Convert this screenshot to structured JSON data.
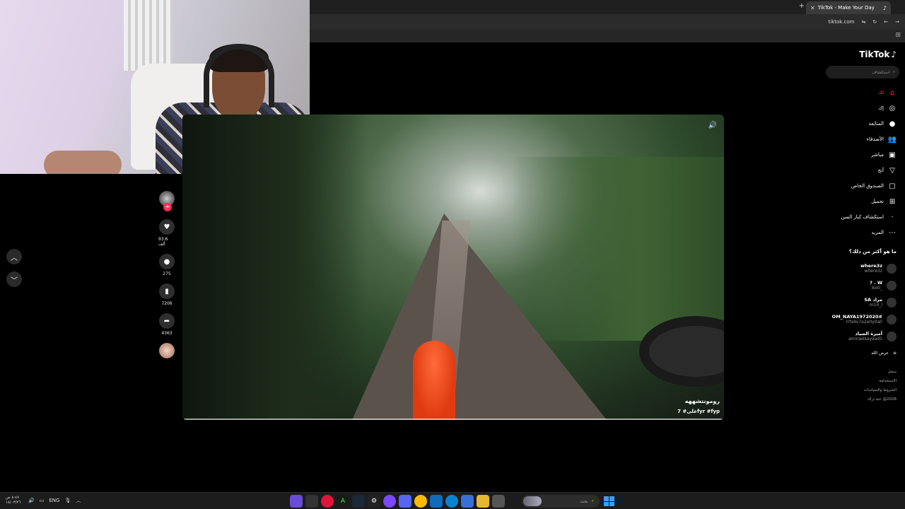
{
  "browser": {
    "tab_title": "TikTok - Make Your Day",
    "url": "tiktok.com",
    "new_tab": "+",
    "tab_close": "✕"
  },
  "video": {
    "title": "رومونتشههه",
    "tags": "على# 7fyr #fyp",
    "volume_icon": "🔊"
  },
  "actions": {
    "follow": "+",
    "like_count": "93.6 ألف",
    "comment_count": "275",
    "save_count": "7206",
    "share_count": "4363"
  },
  "sidebar": {
    "logo": "TikTok",
    "search_placeholder": "استكشاف",
    "nav": [
      {
        "label": "لك",
        "icon": "home-icon",
        "glyph": "⌂"
      },
      {
        "label": "إك",
        "icon": "compass-icon",
        "glyph": "◎"
      },
      {
        "label": "المتابَعة",
        "icon": "following-icon",
        "glyph": "●"
      },
      {
        "label": "الأصدقاء",
        "icon": "friends-icon",
        "glyph": "👥"
      },
      {
        "label": "مباشر",
        "icon": "live-icon",
        "glyph": "▣"
      },
      {
        "label": "آنج",
        "icon": "send-icon",
        "glyph": "▽"
      },
      {
        "label": "الصندوق الخاص",
        "icon": "inbox-icon",
        "glyph": "▢"
      },
      {
        "label": "تحميل",
        "icon": "upload-icon",
        "glyph": "⊞"
      },
      {
        "label": "استكشاف كبار السن",
        "icon": "discover-icon",
        "glyph": "·"
      },
      {
        "label": "المزيد",
        "icon": "more-icon",
        "glyph": "⋯"
      }
    ],
    "following_title": "ما هو أكثر من ذلك؟",
    "following": [
      {
        "name": "where3z",
        "handle": "where3z"
      },
      {
        "name": "W . ?",
        "handle": "_iko0"
      },
      {
        "name": "مراد SA",
        "handle": "m14_l"
      },
      {
        "name": "#OM_NAYA1972020",
        "handle": "rrfa9v7a2a0y0a0"
      },
      {
        "name": "أميرة الصياد",
        "handle": "amiraelsayaad1"
      }
    ],
    "show_more": "عرض الله",
    "footer": [
      "سجل",
      "الاستخدامة",
      "الشروط والسياسات",
      "2026@ عنة تراك"
    ]
  },
  "taskbar": {
    "time": "٨:٤٧ ص",
    "date": "١٨/٠٣/٢٦",
    "lang": "ENG",
    "search_placeholder": "بحث"
  }
}
